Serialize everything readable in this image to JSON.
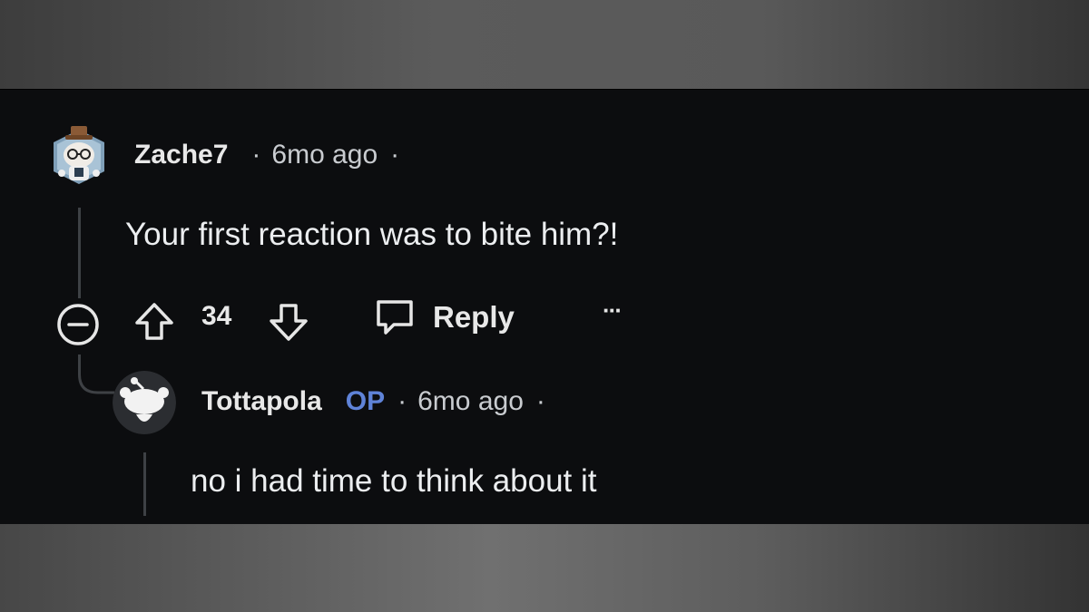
{
  "comments": [
    {
      "username": "Zache7",
      "separator": "·",
      "time": "6mo ago",
      "trailing_dot": "·",
      "body": "Your first reaction was to bite him?!",
      "actions": {
        "vote_count": "34",
        "reply_label": "Reply",
        "more_label": "···"
      }
    },
    {
      "username": "Tottapola",
      "badge": "OP",
      "separator": "·",
      "time": "6mo ago",
      "trailing_dot": "·",
      "body": "no i had time to think about it"
    }
  ],
  "colors": {
    "background": "#0c0d0f",
    "op_badge": "#5f83d8",
    "thread_line": "#3e4145"
  },
  "icons": [
    "avatar-zache7",
    "collapse-icon",
    "upvote-icon",
    "downvote-icon",
    "reply-icon",
    "more-icon",
    "avatar-tottapola"
  ]
}
